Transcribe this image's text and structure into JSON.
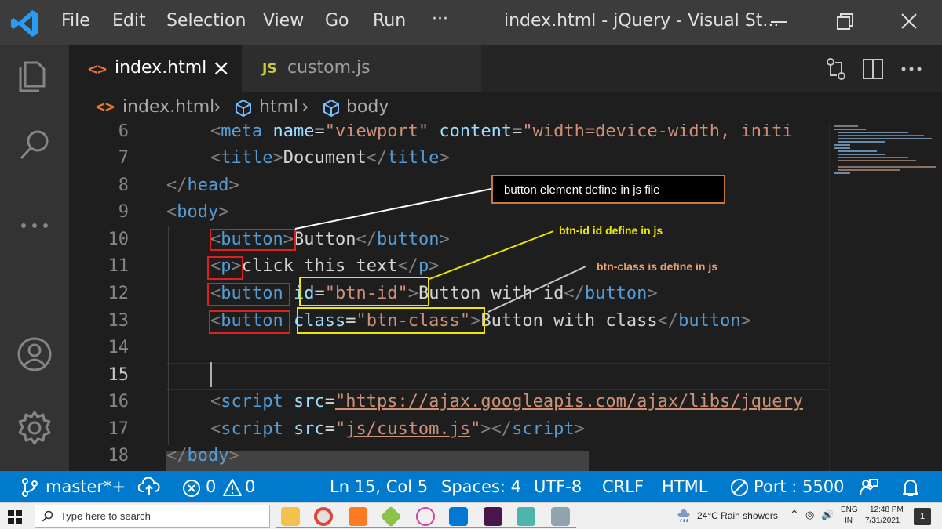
{
  "titlebar": {
    "menus": [
      "File",
      "Edit",
      "Selection",
      "View",
      "Go",
      "Run",
      "···"
    ],
    "window_title": "index.html - jQuery - Visual St..."
  },
  "tabs": [
    {
      "icon_text": "<>",
      "label": "index.html",
      "close": "×"
    },
    {
      "icon_text": "JS",
      "label": "custom.js"
    }
  ],
  "breadcrumb": {
    "file": "index.html",
    "items": [
      "html",
      "body"
    ]
  },
  "editor": {
    "lines": [
      {
        "num": "6"
      },
      {
        "num": "7"
      },
      {
        "num": "8"
      },
      {
        "num": "9"
      },
      {
        "num": "10"
      },
      {
        "num": "11"
      },
      {
        "num": "12"
      },
      {
        "num": "13"
      },
      {
        "num": "14"
      },
      {
        "num": "15"
      },
      {
        "num": "16"
      },
      {
        "num": "17"
      },
      {
        "num": "18"
      }
    ],
    "code": {
      "l6": {
        "open": "<",
        "tag": "meta",
        "a1": " name",
        "eq": "=",
        "v1": "\"viewport\"",
        "a2": " content",
        "v2": "\"width=device-width, initi"
      },
      "l7": {
        "open": "<",
        "tag": "title",
        "close": ">",
        "text": "Document",
        "eopen": "</",
        "etag": "title",
        "eclose": ">"
      },
      "l8": {
        "open": "</",
        "tag": "head",
        "close": ">"
      },
      "l9": {
        "open": "<",
        "tag": "body",
        "close": ">"
      },
      "l10": {
        "open": "<",
        "tag": "button",
        "close": ">",
        "text": "Button",
        "eopen": "</",
        "etag": "button",
        "eclose": ">"
      },
      "l11": {
        "open": "<",
        "tag": "p",
        "close": ">",
        "text": "click this text",
        "eopen": "</",
        "etag": "p",
        "eclose": ">"
      },
      "l12": {
        "open": "<",
        "tag": "button",
        "attr": " id",
        "eq": "=",
        "val": "\"btn-id\"",
        "close": ">",
        "text": "Button with id",
        "eopen": "</",
        "etag": "button",
        "eclose": ">"
      },
      "l13": {
        "open": "<",
        "tag": "button",
        "attr": " class",
        "eq": "=",
        "val": "\"btn-class\"",
        "close": ">",
        "text": "Button with class",
        "eopen": "</",
        "etag": "button",
        "eclose": ">"
      },
      "l16": {
        "open": "<",
        "tag": "script",
        "attr": " src",
        "eq": "=",
        "val": "\"https://ajax.googleapis.com/ajax/libs/jquery"
      },
      "l17": {
        "open": "<",
        "tag": "script",
        "attr": " src",
        "eq": "=",
        "q1": "\"",
        "path": "js/custom.js",
        "q2": "\"",
        "close": ">",
        "eopen": "</",
        "etag": "script",
        "eclose": ">"
      },
      "l18": {
        "open": "</",
        "tag": "body",
        "close": ">"
      }
    }
  },
  "annotations": {
    "box1": "button element define in js file",
    "note2": "btn-id id define in js",
    "note3": "btn-class is define in js",
    "colors": {
      "red": "#e02020",
      "yellow": "#f0e600",
      "white": "#ffffff",
      "orange_border": "#c87a3c",
      "note3_text": "#e8a070"
    }
  },
  "statusbar": {
    "branch": "master*+",
    "errors": "0",
    "warnings": "0",
    "position": "Ln 15, Col 5",
    "spaces": "Spaces: 4",
    "encoding": "UTF-8",
    "eol": "CRLF",
    "language": "HTML",
    "port": "Port : 5500"
  },
  "taskbar": {
    "search_placeholder": "Type here to search",
    "weather": "24°C  Rain showers",
    "lang_top": "ENG",
    "lang_bottom": "IN",
    "time": "12:48 PM",
    "date": "7/31/2021",
    "notif_count": "1"
  },
  "colors": {
    "titlebar_bg": "#3c3c3c",
    "activity_bg": "#333333",
    "editor_bg": "#1e1e1e",
    "statusbar_bg": "#007acc",
    "tag_blue": "#569cd6",
    "attr_lightblue": "#9cdcfe",
    "string_orange": "#ce9178"
  }
}
